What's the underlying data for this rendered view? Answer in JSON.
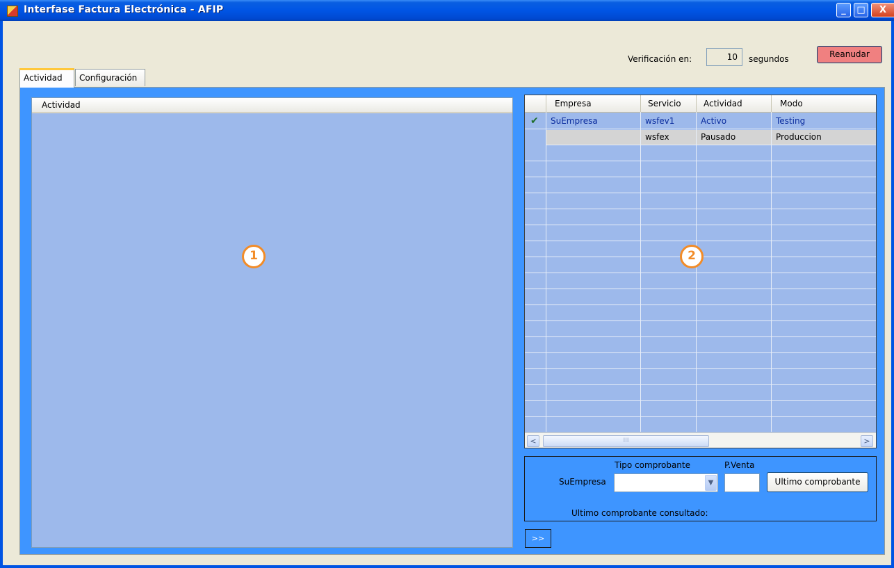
{
  "window": {
    "title": "Interfase Factura Electrónica - AFIP",
    "controls": {
      "minimize": "_",
      "maximize": "□",
      "close": "X"
    }
  },
  "toolbar": {
    "verification_label": "Verificación en:",
    "verification_value": "10",
    "seconds_label": "segundos",
    "resume_label": "Reanudar"
  },
  "tabs": [
    {
      "label": "Actividad",
      "active": true
    },
    {
      "label": "Configuración",
      "active": false
    }
  ],
  "activity_panel": {
    "header": "Actividad",
    "marker": "1"
  },
  "grid": {
    "marker": "2",
    "columns": [
      "Empresa",
      "Servicio",
      "Actividad",
      "Modo"
    ],
    "rows": [
      {
        "check": "✔",
        "empresa": "SuEmpresa",
        "servicio": "wsfev1",
        "actividad": "Activo",
        "modo": "Testing"
      },
      {
        "check": "",
        "empresa": "",
        "servicio": "wsfex",
        "actividad": "Pausado",
        "modo": "Produccion"
      }
    ],
    "scroll_left": "<",
    "scroll_right": ">",
    "scroll_grip": "III"
  },
  "query": {
    "company": "SuEmpresa",
    "type_label": "Tipo comprobante",
    "pv_label": "P.Venta",
    "button_label": "Ultimo comprobante",
    "status_label": "Ultimo comprobante consultado:"
  },
  "expand_button": ">>",
  "colors": {
    "panel_blue": "#3E95FF",
    "list_blue": "#9DB9EB",
    "resume_red": "#F08080",
    "tab_accent": "#FFC83C",
    "marker_orange": "#F28C28"
  }
}
